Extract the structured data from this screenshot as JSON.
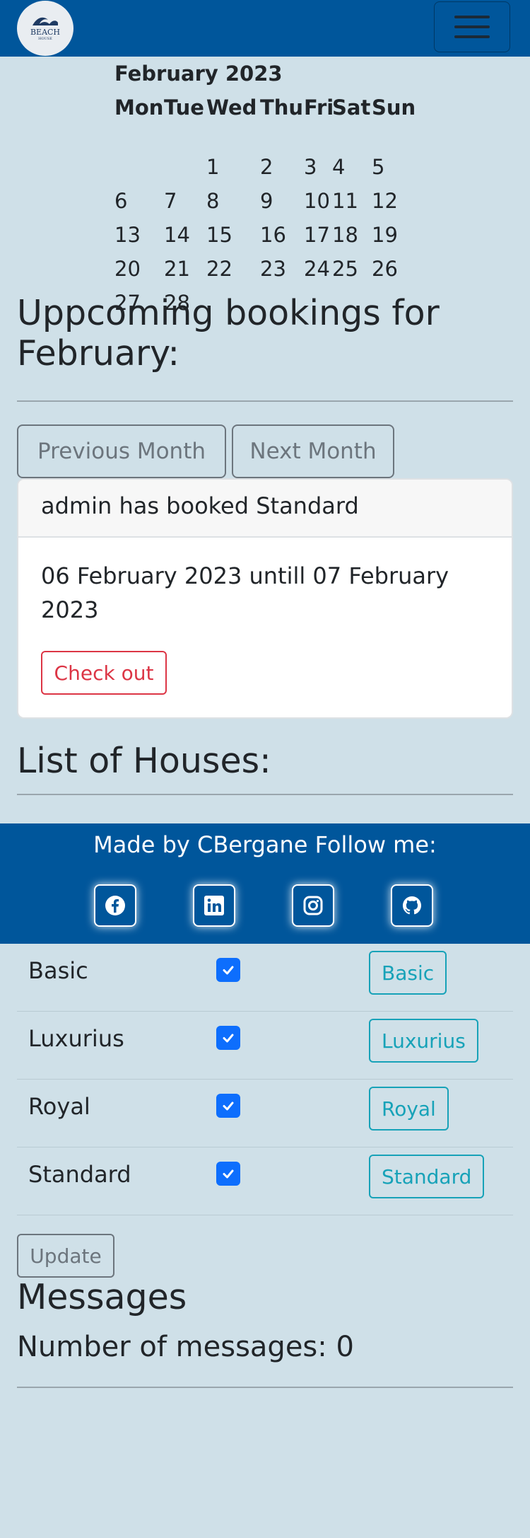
{
  "navbar": {
    "logo_text": "BEACH",
    "logo_subtext": "HOUSE",
    "toggler_icon": "hamburger-menu-icon"
  },
  "calendar": {
    "title": "February 2023",
    "weekdays": [
      "Mon",
      "Tue",
      "Wed",
      "Thu",
      "Fri",
      "Sat",
      "Sun"
    ],
    "weeks": [
      [
        "",
        "",
        "1",
        "2",
        "3",
        "4",
        "5"
      ],
      [
        "6",
        "7",
        "8",
        "9",
        "10",
        "11",
        "12"
      ],
      [
        "13",
        "14",
        "15",
        "16",
        "17",
        "18",
        "19"
      ],
      [
        "20",
        "21",
        "22",
        "23",
        "24",
        "25",
        "26"
      ],
      [
        "27",
        "28",
        "",
        "",
        "",
        "",
        ""
      ]
    ]
  },
  "bookings": {
    "heading": "Uppcoming bookings for February:",
    "prev_label": "Previous Month",
    "next_label": "Next Month",
    "card": {
      "header": "admin has booked Standard",
      "dates": "06 February 2023 untill 07 February 2023",
      "checkout_label": "Check out"
    }
  },
  "houses": {
    "heading": "List of Houses:",
    "items": [
      {
        "name": "Basic",
        "checked": true,
        "button": "Basic"
      },
      {
        "name": "Luxurius",
        "checked": true,
        "button": "Luxurius"
      },
      {
        "name": "Royal",
        "checked": true,
        "button": "Royal"
      },
      {
        "name": "Standard",
        "checked": true,
        "button": "Standard"
      }
    ],
    "update_label": "Update"
  },
  "footer": {
    "text": "Made by CBergane Follow me:",
    "socials": [
      "facebook-icon",
      "linkedin-icon",
      "instagram-icon",
      "github-icon"
    ]
  },
  "messages": {
    "heading": "Messages",
    "count_text": "Number of messages: 0"
  },
  "colors": {
    "navbar": "#00569b",
    "background": "#cfe0e8",
    "danger": "#dc3545",
    "info": "#17a2b8",
    "primary": "#0d6efd"
  }
}
